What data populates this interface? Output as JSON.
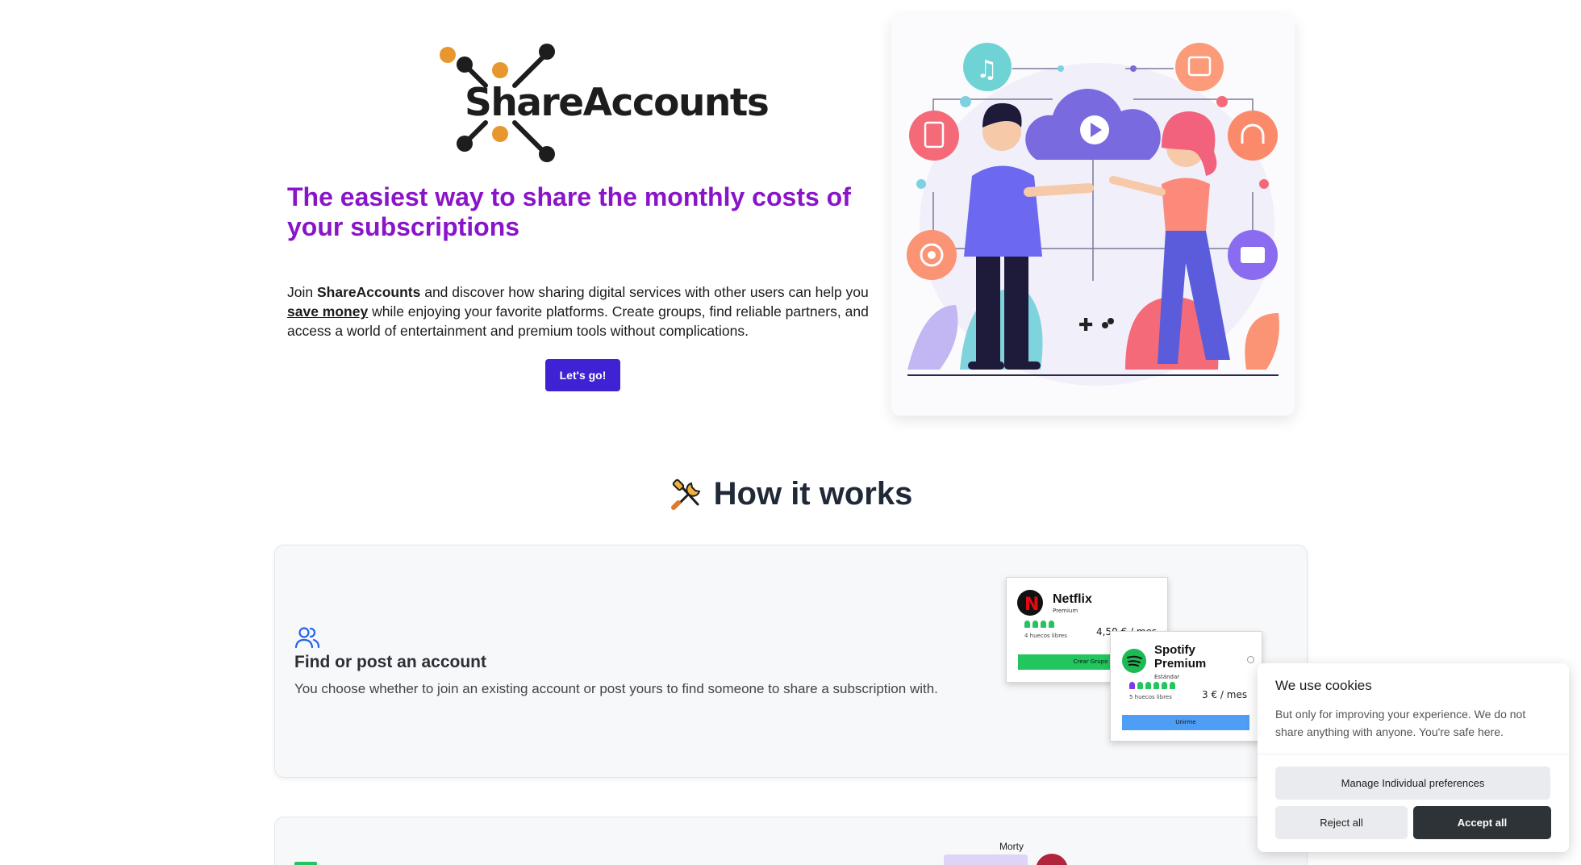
{
  "brand": {
    "name": "ShareAccounts",
    "accent": "#8a14c8",
    "primary": "#3e22d4"
  },
  "hero": {
    "title": "The easiest way to share the monthly costs of your subscriptions",
    "desc_prefix": "Join ",
    "desc_brand": "ShareAccounts",
    "desc_mid": " and discover how sharing digital services with other users can help you ",
    "desc_highlight": "save money",
    "desc_suffix": " while enjoying your favorite platforms. Create groups, find reliable partners, and access a world of entertainment and premium tools without complications.",
    "cta_label": "Let's go!"
  },
  "how_it_works": {
    "title": "How it works",
    "icon": "tools-icon",
    "steps": [
      {
        "icon": "users-icon",
        "title": "Find or post an account",
        "desc": "You choose whether to join an existing account or post yours to find someone to share a subscription with."
      }
    ]
  },
  "mini_cards": {
    "netflix": {
      "name": "Netflix",
      "plan": "Premium",
      "free": "4 huecos libres",
      "price": "4,50 € / mes",
      "button": "Crear Grupo"
    },
    "spotify": {
      "name": "Spotify Premium",
      "plan": "Estándar",
      "free": "5 huecos libres",
      "price": "3 € / mes",
      "button": "Unirme"
    }
  },
  "chat_preview": {
    "user": "Morty"
  },
  "cookie": {
    "title": "We use cookies",
    "text": "But only for improving your experience. We do not share anything with anyone. You're safe here.",
    "manage_label": "Manage Individual preferences",
    "reject_label": "Reject all",
    "accept_label": "Accept all"
  }
}
